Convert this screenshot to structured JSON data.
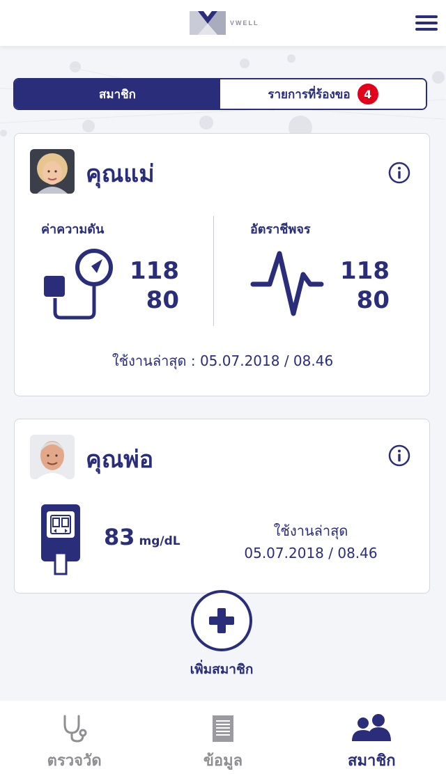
{
  "app": {
    "logo_text": "VWELL"
  },
  "tabs": [
    {
      "label": "สมาชิก",
      "active": true
    },
    {
      "label": "รายการที่ร้องขอ",
      "active": false,
      "badge": "4"
    }
  ],
  "members": [
    {
      "name": "คุณแม่",
      "blood_pressure": {
        "label": "ค่าความดัน",
        "systolic": "118",
        "diastolic": "80"
      },
      "heart_rate": {
        "label": "อัตราชีพจร",
        "value_top": "118",
        "value_bottom": "80"
      },
      "last_used": "ใช้งานล่าสุด : 05.07.2018 / 08.46"
    },
    {
      "name": "คุณพ่อ",
      "glucose": {
        "value": "83",
        "unit": "mg/dL"
      },
      "last_used_label": "ใช้งานล่าสุด",
      "last_used_value": "05.07.2018 / 08.46"
    }
  ],
  "add_member": {
    "label": "เพิ่มสมาชิก"
  },
  "bottom_nav": [
    {
      "label": "ตรวจวัด",
      "icon": "stethoscope-icon",
      "active": false
    },
    {
      "label": "ข้อมูล",
      "icon": "document-icon",
      "active": false
    },
    {
      "label": "สมาชิก",
      "icon": "users-icon",
      "active": true
    }
  ],
  "colors": {
    "primary": "#2a2e7a",
    "badge": "#e3001b",
    "inactive": "#8e8e93"
  }
}
